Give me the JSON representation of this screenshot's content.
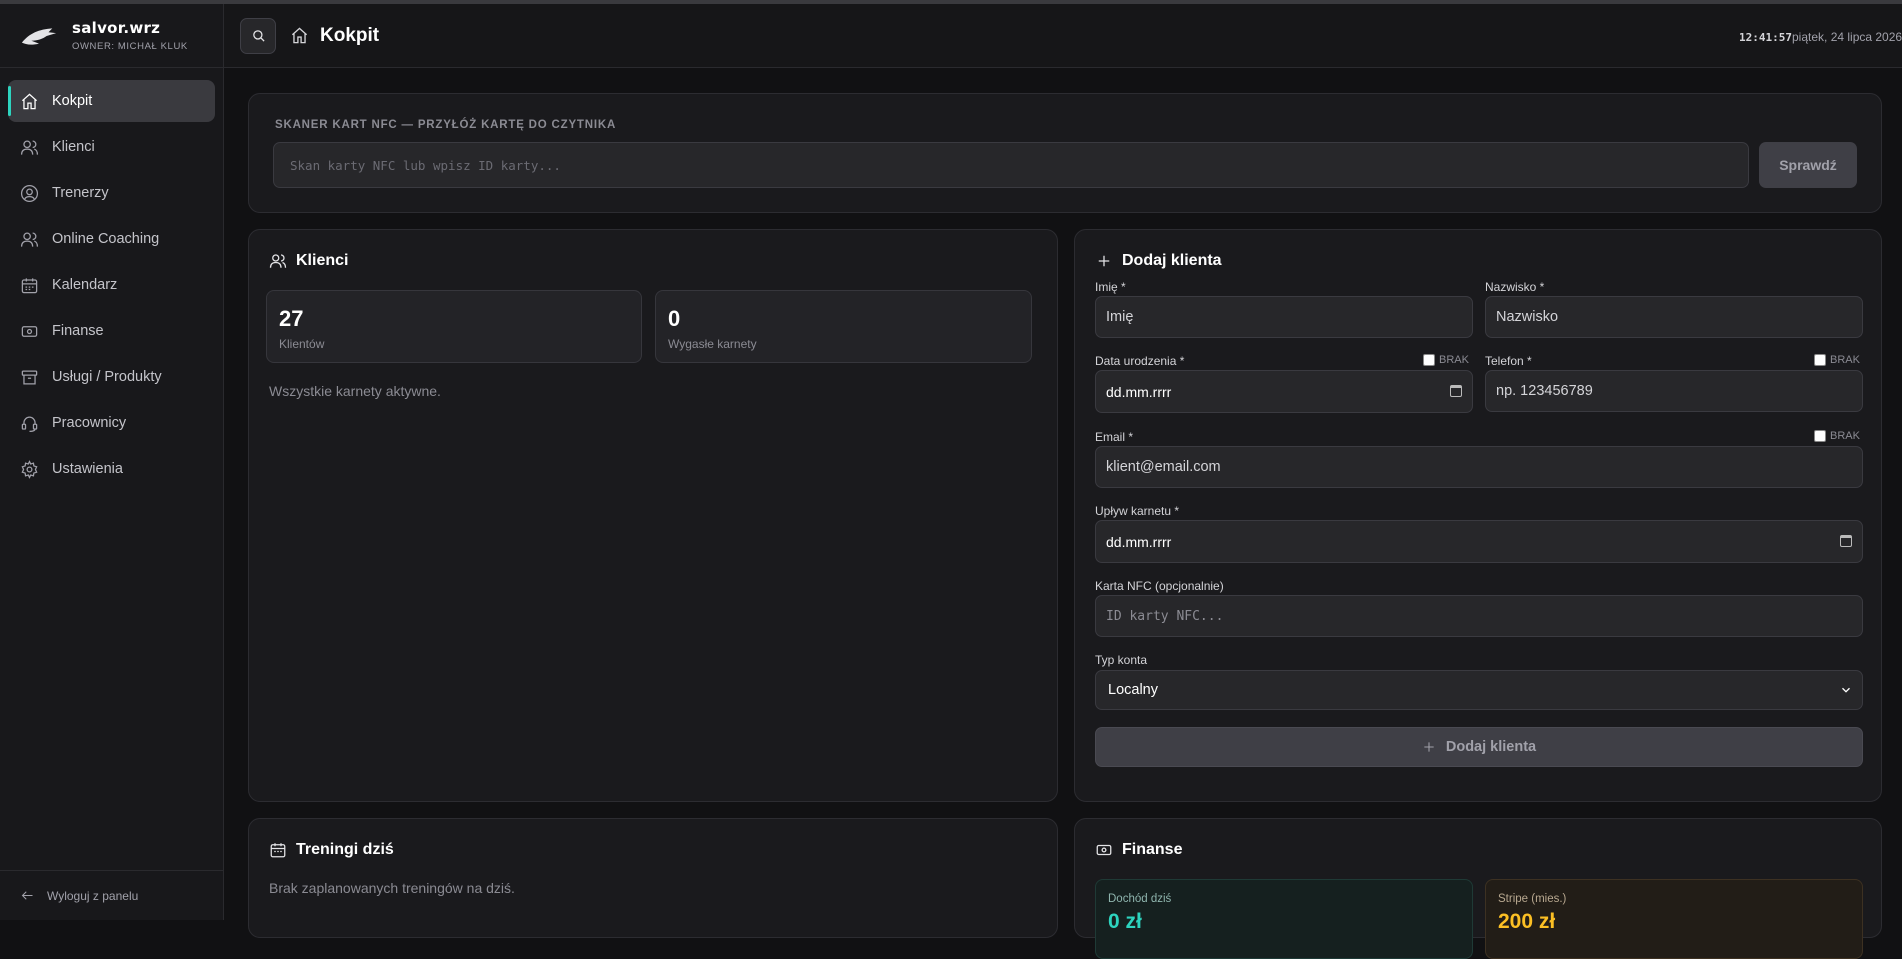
{
  "brand": {
    "name": "salvor.wrz",
    "owner": "OWNER: MICHAŁ KLUK"
  },
  "sidebar": {
    "items": [
      {
        "label": "Kokpit"
      },
      {
        "label": "Klienci"
      },
      {
        "label": "Trenerzy"
      },
      {
        "label": "Online Coaching"
      },
      {
        "label": "Kalendarz"
      },
      {
        "label": "Finanse"
      },
      {
        "label": "Usługi / Produkty"
      },
      {
        "label": "Pracownicy"
      },
      {
        "label": "Ustawienia"
      }
    ],
    "logout": "Wyloguj z panelu"
  },
  "topbar": {
    "title": "Kokpit",
    "time": "12:41:57",
    "date": "piątek, 24 lipca 2026"
  },
  "nfc": {
    "title": "SKANER KART NFC — PRZYŁÓŻ KARTĘ DO CZYTNIKA",
    "placeholder": "Skan karty NFC lub wpisz ID karty...",
    "button": "Sprawdź"
  },
  "klienci": {
    "title": "Klienci",
    "stats": [
      {
        "value": "27",
        "label": "Klientów"
      },
      {
        "value": "0",
        "label": "Wygasłe karnety"
      }
    ],
    "note": "Wszystkie karnety aktywne."
  },
  "dodaj": {
    "title": "Dodaj klienta",
    "imie": {
      "label": "Imię *",
      "placeholder": "Imię"
    },
    "nazwisko": {
      "label": "Nazwisko *",
      "placeholder": "Nazwisko"
    },
    "data_urodzenia": {
      "label": "Data urodzenia *",
      "value": "dd.mm.rrrr",
      "brak": "BRAK"
    },
    "telefon": {
      "label": "Telefon *",
      "placeholder": "np. 123456789",
      "brak": "BRAK"
    },
    "email": {
      "label": "Email *",
      "placeholder": "klient@email.com",
      "brak": "BRAK"
    },
    "uplyw": {
      "label": "Upływ karnetu *",
      "value": "dd.mm.rrrr"
    },
    "nfc": {
      "label": "Karta NFC (opcjonalnie)",
      "placeholder": "ID karty NFC..."
    },
    "typ": {
      "label": "Typ konta",
      "value": "Localny"
    },
    "button": "Dodaj klienta"
  },
  "treningi": {
    "title": "Treningi dziś",
    "note": "Brak zaplanowanych treningów na dziś."
  },
  "finanse": {
    "title": "Finanse",
    "boxes": [
      {
        "label": "Dochód dziś",
        "value": "0 zł",
        "color": "#2dd4bf"
      },
      {
        "label": "Stripe (mies.)",
        "value": "200 zł",
        "color": "#fbbf24"
      }
    ]
  }
}
